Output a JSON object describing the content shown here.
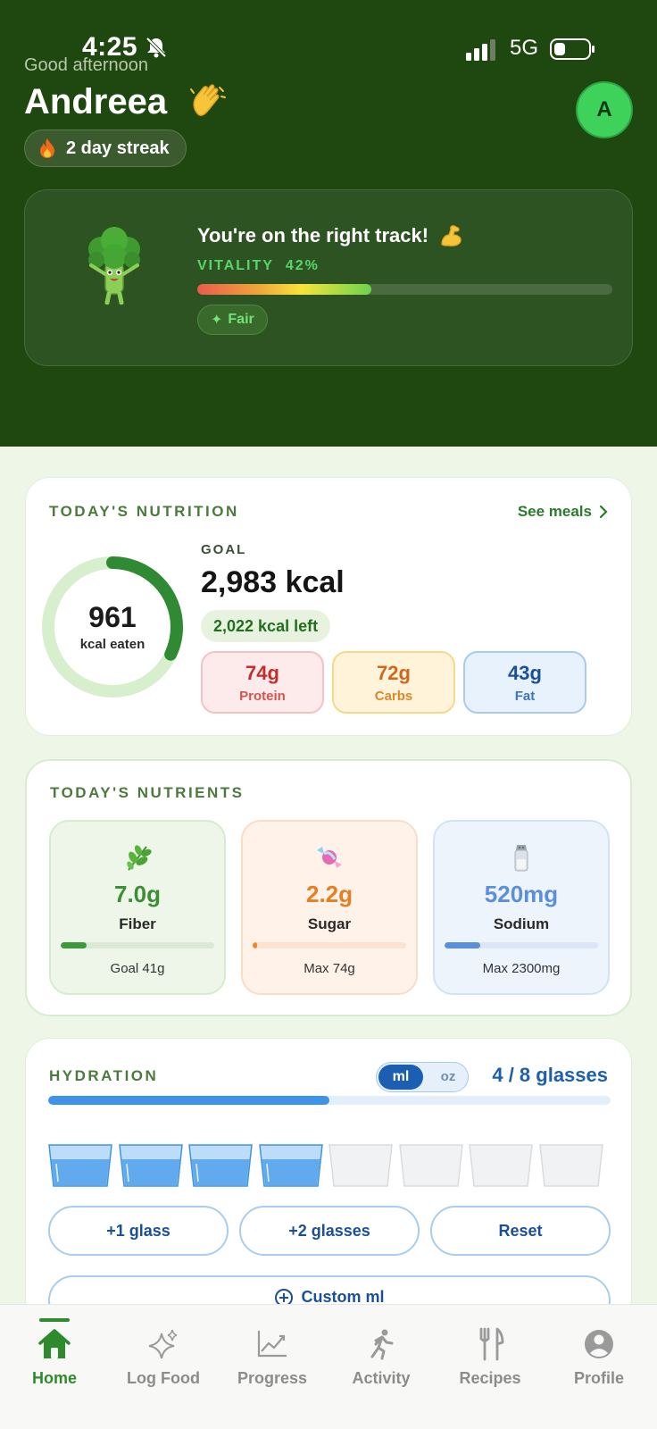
{
  "status": {
    "time": "4:25",
    "network": "5G"
  },
  "header": {
    "greeting": "Good afternoon",
    "name": "Andreea",
    "avatar_initial": "A",
    "streak": "2 day streak"
  },
  "vitality": {
    "message": "You're on the right track!",
    "label": "VITALITY",
    "percent_text": "42%",
    "percent": 0.42,
    "rating": "Fair"
  },
  "nutrition": {
    "title": "TODAY'S NUTRITION",
    "see_meals": "See meals",
    "eaten": "961",
    "eaten_label": "kcal eaten",
    "eaten_fraction": 0.32,
    "goal_label": "GOAL",
    "goal": "2,983 kcal",
    "left": "2,022 kcal left",
    "macros": [
      {
        "value": "74g",
        "label": "Protein"
      },
      {
        "value": "72g",
        "label": "Carbs"
      },
      {
        "value": "43g",
        "label": "Fat"
      }
    ]
  },
  "nutrients": {
    "title": "TODAY'S NUTRIENTS",
    "items": [
      {
        "value": "7.0g",
        "name": "Fiber",
        "goal": "Goal 41g",
        "fraction": 0.17,
        "icon": "herb-icon"
      },
      {
        "value": "2.2g",
        "name": "Sugar",
        "goal": "Max 74g",
        "fraction": 0.03,
        "icon": "candy-icon"
      },
      {
        "value": "520mg",
        "name": "Sodium",
        "goal": "Max 2300mg",
        "fraction": 0.23,
        "icon": "salt-shaker-icon"
      }
    ]
  },
  "hydration": {
    "title": "HYDRATION",
    "unit_ml": "ml",
    "unit_oz": "oz",
    "count": "4 / 8 glasses",
    "filled": 4,
    "total": 8,
    "add_one": "+1 glass",
    "add_two": "+2 glasses",
    "reset": "Reset",
    "custom": "Custom ml"
  },
  "tabs": [
    {
      "label": "Home",
      "icon": "home-icon"
    },
    {
      "label": "Log Food",
      "icon": "sparkle-icon"
    },
    {
      "label": "Progress",
      "icon": "chart-icon"
    },
    {
      "label": "Activity",
      "icon": "running-icon"
    },
    {
      "label": "Recipes",
      "icon": "utensils-icon"
    },
    {
      "label": "Profile",
      "icon": "person-icon"
    }
  ],
  "colors": {
    "hero": "#1f4710",
    "accent": "#2d8a2d",
    "water": "#3f93e6"
  }
}
